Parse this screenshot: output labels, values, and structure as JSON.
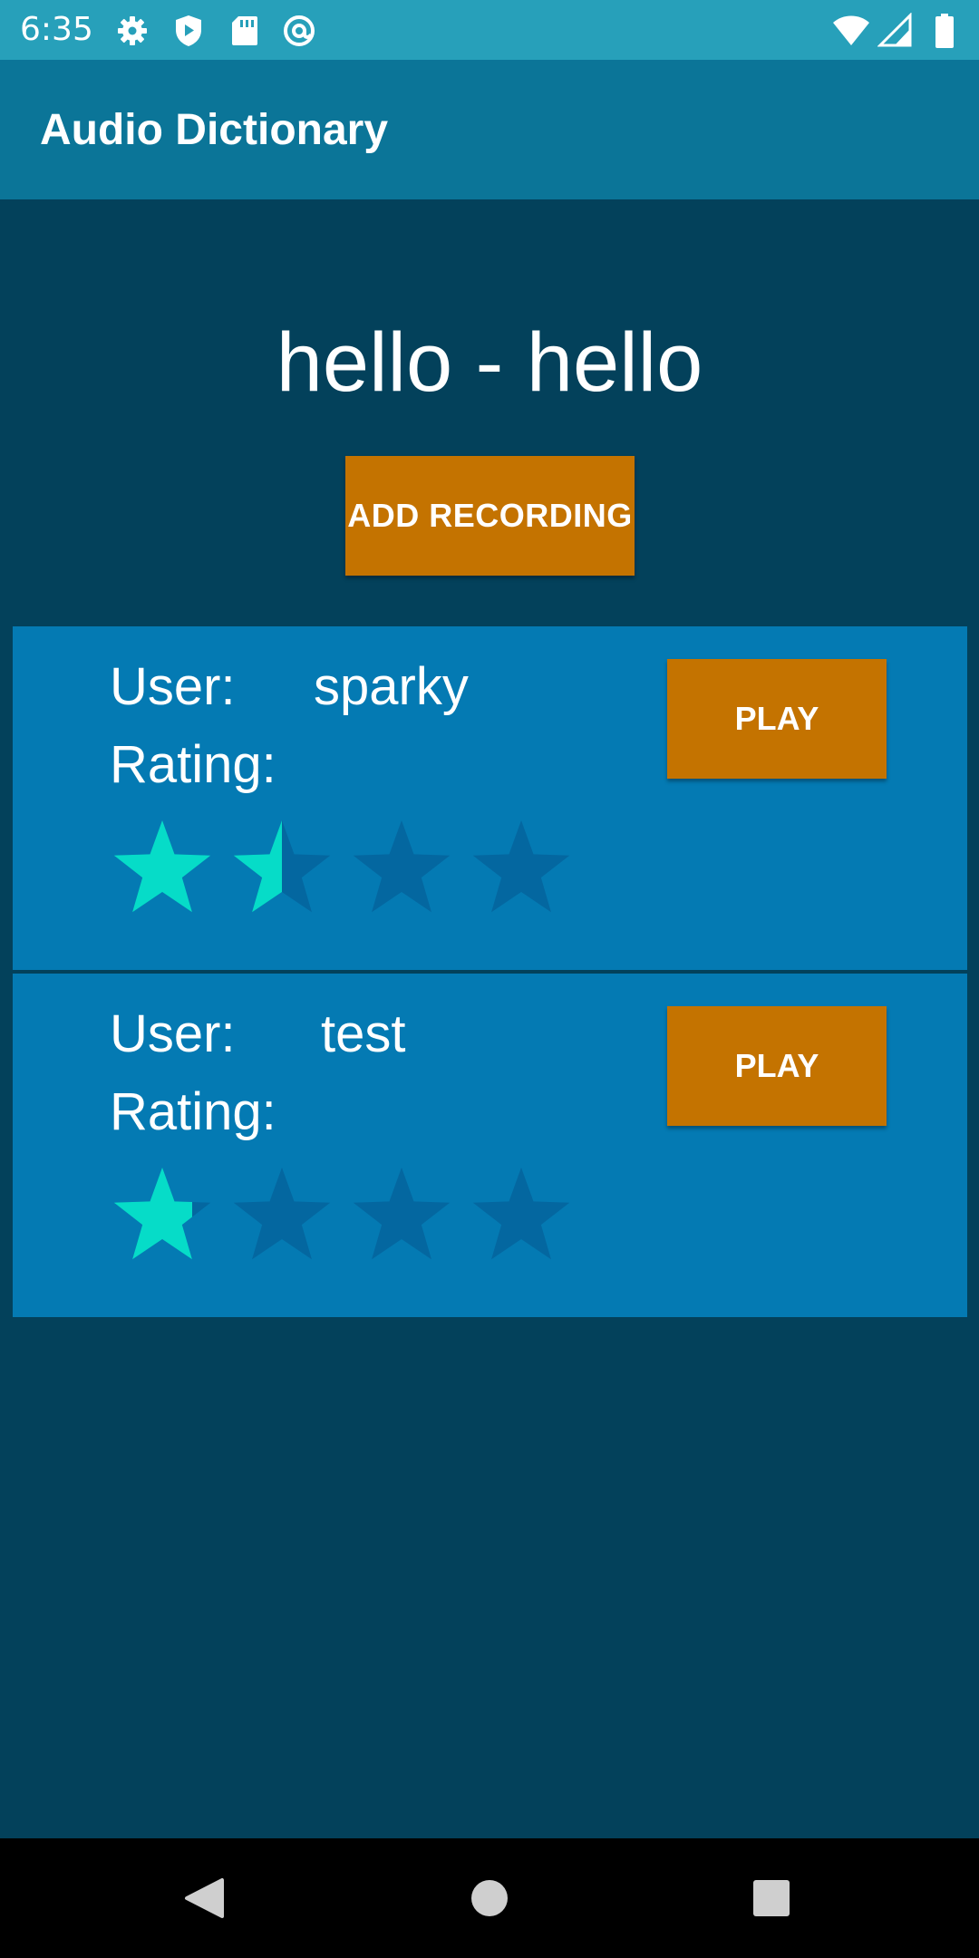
{
  "status_bar": {
    "time": "6:35",
    "left_icons": [
      "settings-gear-icon",
      "shield-play-icon",
      "sd-card-icon",
      "at-sign-icon"
    ],
    "right_icons": [
      "wifi-icon",
      "cell-signal-icon",
      "battery-icon"
    ]
  },
  "app_bar": {
    "title": "Audio Dictionary"
  },
  "word": {
    "heading": "hello - hello"
  },
  "add_recording": {
    "label": "ADD RECORDING"
  },
  "recordings": [
    {
      "user_label": "User:",
      "user_value": "sparky",
      "rating_label": "Rating:",
      "rating": 1.5,
      "rating_max": 4,
      "play_label": "PLAY"
    },
    {
      "user_label": "User:",
      "user_value": "test",
      "rating_label": "Rating:",
      "rating": 0.8,
      "rating_max": 4,
      "play_label": "PLAY"
    }
  ],
  "nav_bar": {
    "buttons": [
      "back-icon",
      "home-icon",
      "recents-icon"
    ]
  },
  "colors": {
    "status_bar": "#27a0ba",
    "app_bar": "#0b7598",
    "background": "#03415b",
    "card": "#047ab3",
    "button": "#c47300",
    "star_filled": "#06dcc8",
    "star_empty": "#0467a0"
  }
}
